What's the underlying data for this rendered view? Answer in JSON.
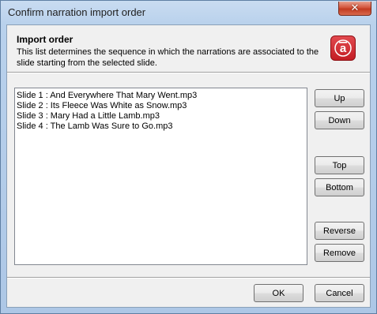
{
  "window": {
    "title": "Confirm narration import order",
    "close_glyph": "✕"
  },
  "header": {
    "title": "Import order",
    "description": "This list determines the sequence in which the narrations are associated to the slide starting from the selected slide.",
    "logo_glyph": "a",
    "logo_color": "#c41d24"
  },
  "list": {
    "items": [
      "Slide 1 : And Everywhere That Mary Went.mp3",
      "Slide 2 : Its Fleece Was White as Snow.mp3",
      "Slide 3 : Mary Had a Little Lamb.mp3",
      "Slide 4 : The Lamb Was Sure to Go.mp3"
    ]
  },
  "buttons": {
    "up": "Up",
    "down": "Down",
    "top": "Top",
    "bottom": "Bottom",
    "reverse": "Reverse",
    "remove": "Remove",
    "ok": "OK",
    "cancel": "Cancel"
  }
}
